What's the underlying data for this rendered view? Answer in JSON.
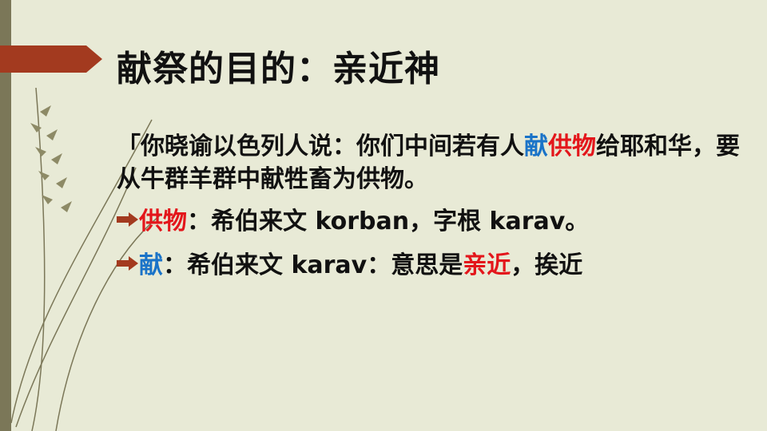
{
  "slide": {
    "title": "献祭的目的：亲近神",
    "quote": {
      "part1": "「你晓谕以色列人说：你们中间若有人",
      "highlight_blue": "献",
      "highlight_red": "供物",
      "part2": "给耶和华，要从牛群羊群中献牲畜为供物。"
    },
    "bullets": [
      {
        "term": "供物",
        "term_color": "#e3161b",
        "text": "：希伯来文 korban，字根 karav。"
      },
      {
        "term": "献",
        "term_color": "#1a73c8",
        "text_before": "：希伯来文 karav：意思是",
        "highlight": "亲近",
        "text_after": "，挨近"
      }
    ],
    "icons": [
      "bullet-arrow-icon"
    ],
    "colors": {
      "background": "#e8ead6",
      "accent_arrow": "#a33a1f",
      "side_bar": "#7b7758",
      "red": "#e3161b",
      "blue": "#1a73c8"
    }
  }
}
